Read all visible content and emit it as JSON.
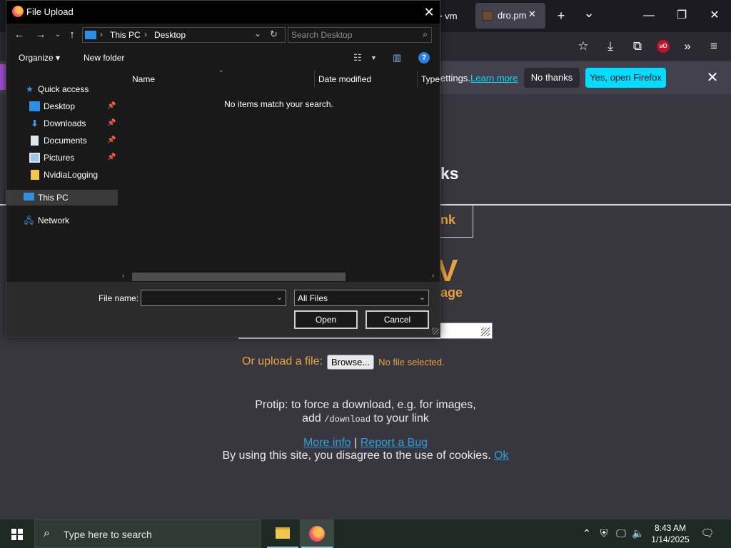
{
  "browser": {
    "tabs": {
      "partial_label": "> vm",
      "active_title": "dro.pm",
      "close_glyph": "✕"
    },
    "new_tab_glyph": "+",
    "tab_list_glyph": "⌄",
    "window_controls": {
      "minimize": "—",
      "restore": "❐",
      "close": "✕"
    },
    "toolbar_icons": [
      "bookmark-star-icon",
      "downloads-icon",
      "extensions-icon",
      "ublock-icon",
      "overflow-icon",
      "menu-icon"
    ],
    "ublock_label": "uO",
    "notification": {
      "message_fragment": "ettings.",
      "learn_more": "Learn more",
      "no_thanks": "No thanks",
      "yes_open": "Yes, open Firefox",
      "accent_color": "#00ddff"
    }
  },
  "page": {
    "heading_fragment": "ks",
    "link_box_fragment": "nk",
    "logo_fragment": "V",
    "logo_sub_fragment": "age",
    "upload_label": "Or upload a file:",
    "browse_button": "Browse...",
    "no_file": "No file selected.",
    "protip_line1": "Protip: to force a download, e.g. for images,",
    "protip_add": "add",
    "protip_code": "/download",
    "protip_tail": "to your link",
    "more_info": "More info",
    "separator": "|",
    "report_bug": "Report a Bug",
    "cookie_text": "By using this site, you disagree to the use of cookies.",
    "cookie_ok": "Ok",
    "accent_color": "#e8a33c"
  },
  "dialog": {
    "title": "File Upload",
    "breadcrumb": [
      "This PC",
      "Desktop"
    ],
    "search_placeholder": "Search Desktop",
    "organize": "Organize ▾",
    "new_folder": "New folder",
    "help": "?",
    "nav": {
      "quick_access": "Quick access",
      "desktop": "Desktop",
      "downloads": "Downloads",
      "documents": "Documents",
      "pictures": "Pictures",
      "nvidia": "NvidiaLogging",
      "this_pc": "This PC",
      "network": "Network"
    },
    "columns": {
      "name": "Name",
      "date_modified": "Date modified",
      "type": "Type"
    },
    "empty_message": "No items match your search.",
    "file_name_label": "File name:",
    "file_name_value": "",
    "file_type": "All Files",
    "open_button": "Open",
    "cancel_button": "Cancel"
  },
  "taskbar": {
    "search_placeholder": "Type here to search",
    "time": "8:43 AM",
    "date": "1/14/2025",
    "apps": [
      "file-explorer-icon",
      "firefox-icon"
    ]
  }
}
